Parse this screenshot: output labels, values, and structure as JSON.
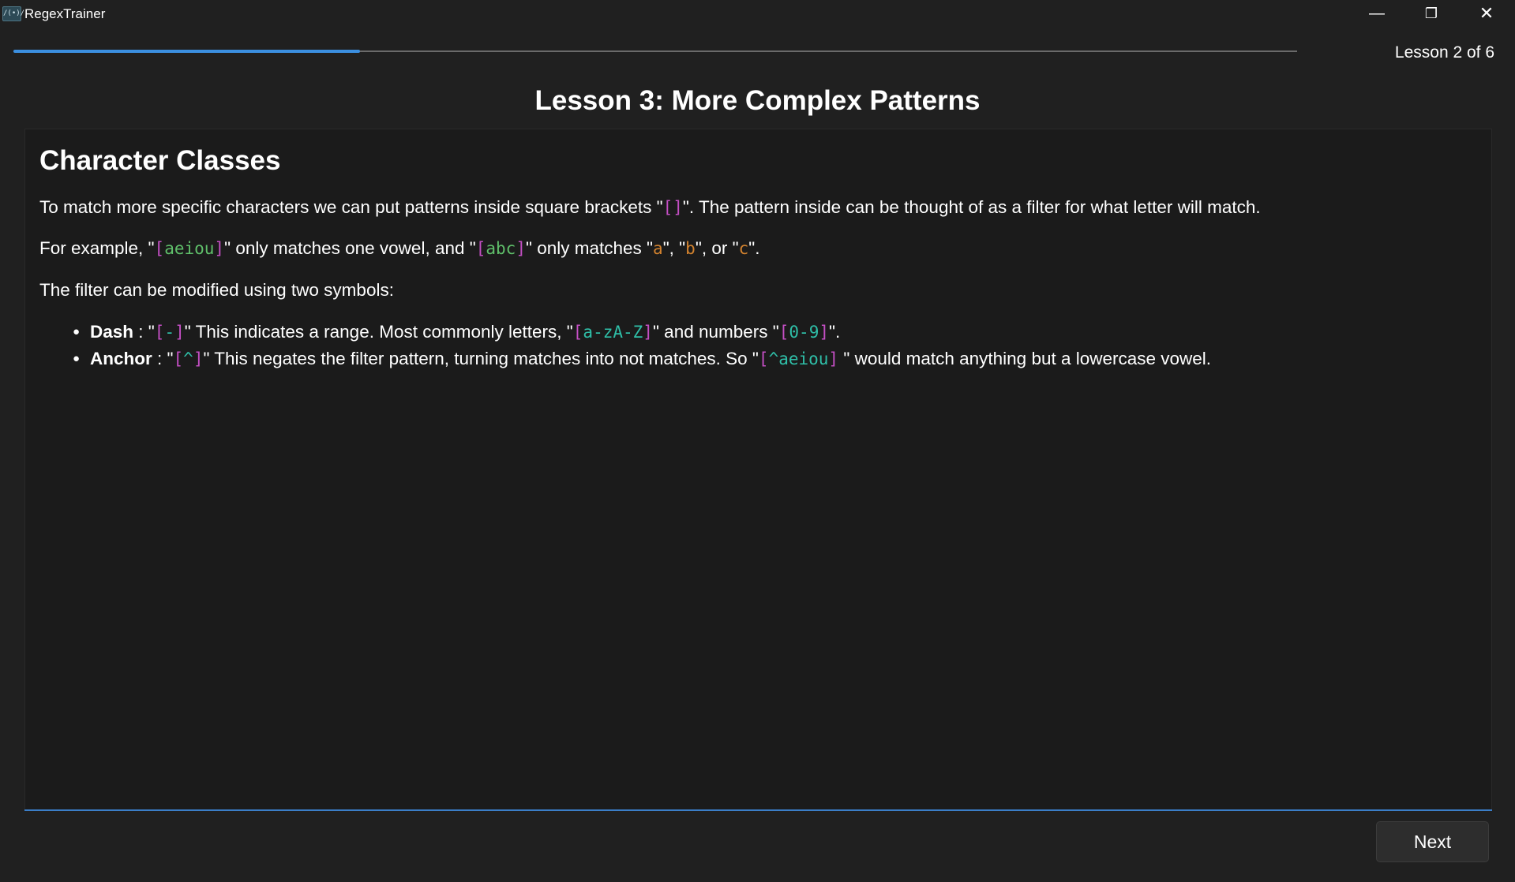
{
  "window": {
    "icon": "/(•)/",
    "title": "RegexTrainer",
    "minimize_icon": "minimize-icon",
    "maximize_icon": "restore-icon",
    "close_icon": "close-icon"
  },
  "progress": {
    "fraction": 0.27,
    "label": "Lesson 2 of 6",
    "color": "#3b8fe0"
  },
  "lesson_title": "Lesson 3: More Complex Patterns",
  "content": {
    "section_title": "Character Classes",
    "p1": {
      "text_a": "To match more specific characters we can put patterns inside square brackets \"",
      "code_a": "[]",
      "text_b": "\". The pattern inside can be thought of as a filter for what letter will match."
    },
    "p2": {
      "text_a": "For example, \"",
      "code_a_open": "[",
      "code_a_inner": "aeiou",
      "code_a_close": "]",
      "text_b": "\" only matches one vowel, and \"",
      "code_b_open": "[",
      "code_b_inner": "abc",
      "code_b_close": "]",
      "text_c": "\" only matches \"",
      "lit_a": "a",
      "text_d": "\", \"",
      "lit_b": "b",
      "text_e": "\", or \"",
      "lit_c": "c",
      "text_f": "\"."
    },
    "p3": "The filter can be modified using two symbols:",
    "bullets": [
      {
        "term": "Dash",
        "text_a": " : \"",
        "sym_open": "[",
        "sym_inner": "-",
        "sym_close": "]",
        "text_b": "\" This indicates a range. Most commonly letters, \"",
        "ex1_open": "[",
        "ex1_inner": "a-zA-Z",
        "ex1_close": "]",
        "text_c": "\" and numbers \"",
        "ex2_open": "[",
        "ex2_inner": "0-9",
        "ex2_close": "]",
        "text_d": "\"."
      },
      {
        "term": "Anchor",
        "text_a": " : \"",
        "sym_open": "[",
        "sym_inner": "^",
        "sym_close": "]",
        "text_b": "\" This negates the filter pattern, turning matches into not matches. So \"",
        "ex1_open": "[",
        "ex1_inner": "^aeiou",
        "ex1_close": "]",
        "text_c": " \" would match anything but a lowercase vowel."
      }
    ]
  },
  "next_label": "Next"
}
